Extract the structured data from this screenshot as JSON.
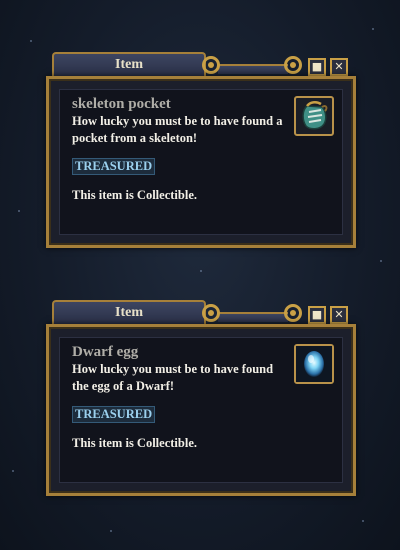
{
  "windows": [
    {
      "title": "Item",
      "item_name": "skeleton pocket",
      "description": "How lucky you must be to have found a pocket from a skeleton!",
      "badge": "TREASURED",
      "collectible_text": "This item is Collectible.",
      "icon": "skeleton-pocket-icon"
    },
    {
      "title": "Item",
      "item_name": "Dwarf egg",
      "description": "How lucky you must be to have found the egg of a Dwarf!",
      "badge": "TREASURED",
      "collectible_text": "This item is Collectible.",
      "icon": "dwarf-egg-icon"
    }
  ],
  "controls": {
    "pin_glyph": "■",
    "close_glyph": "✕"
  },
  "colors": {
    "accent_gold": "#a6803a",
    "badge_text": "#9bd0ee",
    "panel_bg": "#11131c"
  }
}
